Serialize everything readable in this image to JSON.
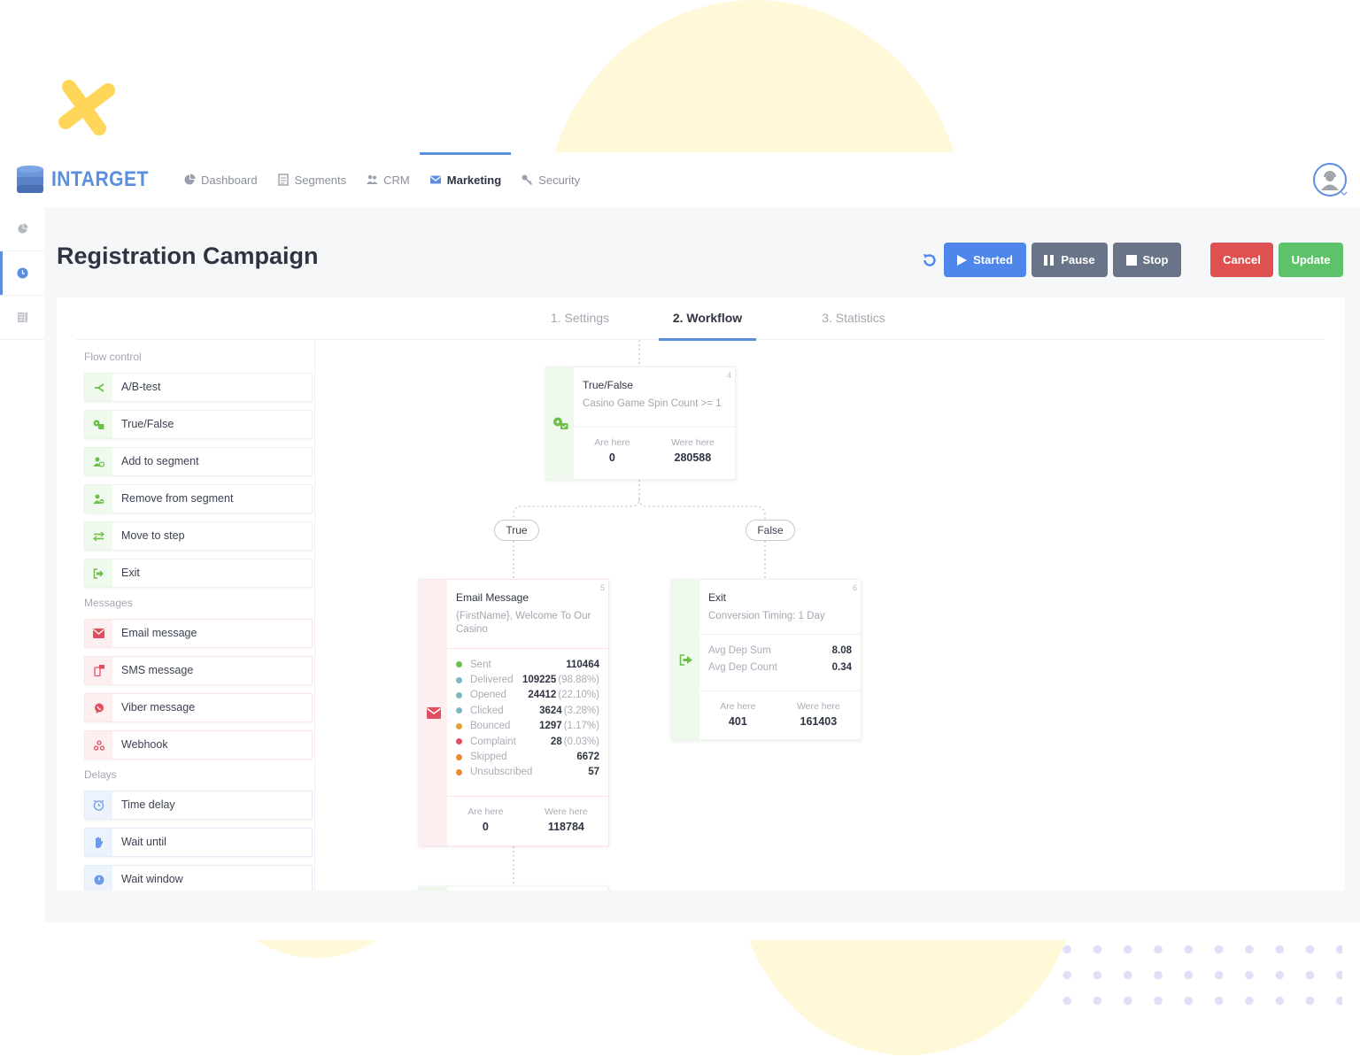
{
  "app": {
    "brand": "INTARGET"
  },
  "nav": {
    "items": [
      {
        "label": "Dashboard",
        "icon": "pie-chart-icon",
        "active": false
      },
      {
        "label": "Segments",
        "icon": "document-icon",
        "active": false
      },
      {
        "label": "CRM",
        "icon": "users-icon",
        "active": false
      },
      {
        "label": "Marketing",
        "icon": "envelope-icon",
        "active": true
      },
      {
        "label": "Security",
        "icon": "key-icon",
        "active": false
      }
    ]
  },
  "rail": [
    {
      "icon": "pie-chart-icon",
      "active": false
    },
    {
      "icon": "clock-icon",
      "active": true
    },
    {
      "icon": "list-icon",
      "active": false
    }
  ],
  "page": {
    "title": "Registration Campaign",
    "actions": {
      "refresh_icon": "refresh-icon",
      "started": "Started",
      "pause": "Pause",
      "stop": "Stop",
      "cancel": "Cancel",
      "update": "Update"
    },
    "colors": {
      "accent": "#5b8fde",
      "started": "#4f86ec",
      "neutral": "#6a7488",
      "cancel": "#de5150",
      "update": "#5ec26a"
    }
  },
  "tabs": [
    {
      "label": "1. Settings",
      "active": false
    },
    {
      "label": "2. Workflow",
      "active": true
    },
    {
      "label": "3. Statistics",
      "active": false
    }
  ],
  "palette": {
    "flow_control": {
      "title": "Flow control",
      "items": [
        "A/B-test",
        "True/False",
        "Add to segment",
        "Remove from segment",
        "Move to step",
        "Exit"
      ]
    },
    "messages": {
      "title": "Messages",
      "items": [
        "Email message",
        "SMS message",
        "Viber message",
        "Webhook"
      ]
    },
    "delays": {
      "title": "Delays",
      "items": [
        "Time delay",
        "Wait until",
        "Wait window"
      ]
    }
  },
  "workflow": {
    "true_false_node": {
      "number": "4",
      "title": "True/False",
      "subtitle": "Casino Game Spin Count >= 1",
      "are_here_label": "Are here",
      "are_here": "0",
      "were_here_label": "Were here",
      "were_here": "280588"
    },
    "branches": {
      "true_label": "True",
      "false_label": "False"
    },
    "email_node": {
      "number": "5",
      "title": "Email Message",
      "subtitle": "{FirstName}, Welcome To Our Casino",
      "stats": [
        {
          "label": "Sent",
          "value": "110464",
          "pct": "",
          "color": "#6cc04a"
        },
        {
          "label": "Delivered",
          "value": "109225",
          "pct": "(98.88%)",
          "color": "#7bb8c4"
        },
        {
          "label": "Opened",
          "value": "24412",
          "pct": "(22.10%)",
          "color": "#7bb8c4"
        },
        {
          "label": "Clicked",
          "value": "3624",
          "pct": "(3.28%)",
          "color": "#7bb8c4"
        },
        {
          "label": "Bounced",
          "value": "1297",
          "pct": "(1.17%)",
          "color": "#e0a33a"
        },
        {
          "label": "Complaint",
          "value": "28",
          "pct": "(0.03%)",
          "color": "#e24d5f"
        },
        {
          "label": "Skipped",
          "value": "6672",
          "pct": "",
          "color": "#ec8a2e"
        },
        {
          "label": "Unsubscribed",
          "value": "57",
          "pct": "",
          "color": "#ec8a2e"
        }
      ],
      "are_here_label": "Are here",
      "are_here": "0",
      "were_here_label": "Were here",
      "were_here": "118784"
    },
    "exit_node": {
      "number": "6",
      "title": "Exit",
      "subtitle": "Conversion Timing: 1 Day",
      "metrics": [
        {
          "label": "Avg Dep Sum",
          "value": "8.08"
        },
        {
          "label": "Avg Dep Count",
          "value": "0.34"
        }
      ],
      "are_here_label": "Are here",
      "are_here": "401",
      "were_here_label": "Were here",
      "were_here": "161403"
    }
  }
}
